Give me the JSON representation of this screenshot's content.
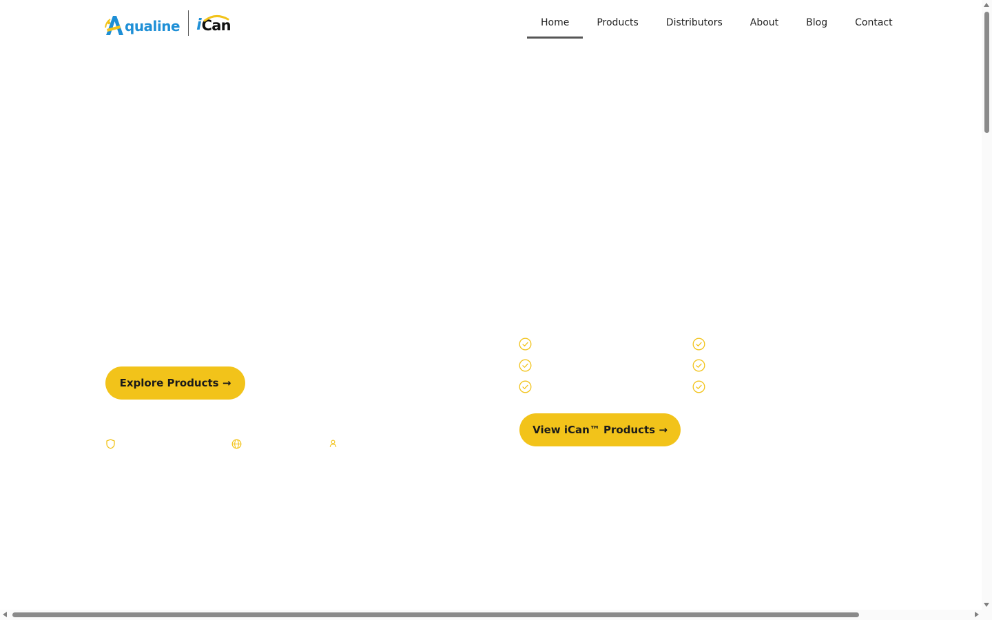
{
  "brand": {
    "aqualine_text": "qualine",
    "ican_i": "i",
    "ican_can": "Can",
    "blue": "#1e8fd6",
    "yellow": "#f2c31a"
  },
  "nav": {
    "items": [
      {
        "label": "Home",
        "active": true
      },
      {
        "label": "Products",
        "active": false
      },
      {
        "label": "Distributors",
        "active": false
      },
      {
        "label": "About",
        "active": false
      },
      {
        "label": "Blog",
        "active": false
      },
      {
        "label": "Contact",
        "active": false
      }
    ]
  },
  "hero": {
    "explore_label": "Explore Products →",
    "badge_icons": [
      "shield-icon",
      "globe-icon",
      "user-icon"
    ]
  },
  "ican_section": {
    "check_icons": 6,
    "view_label": "View iCan™ Products →"
  },
  "colors": {
    "accent": "#f2c31a",
    "nav_active_underline": "#555555"
  }
}
